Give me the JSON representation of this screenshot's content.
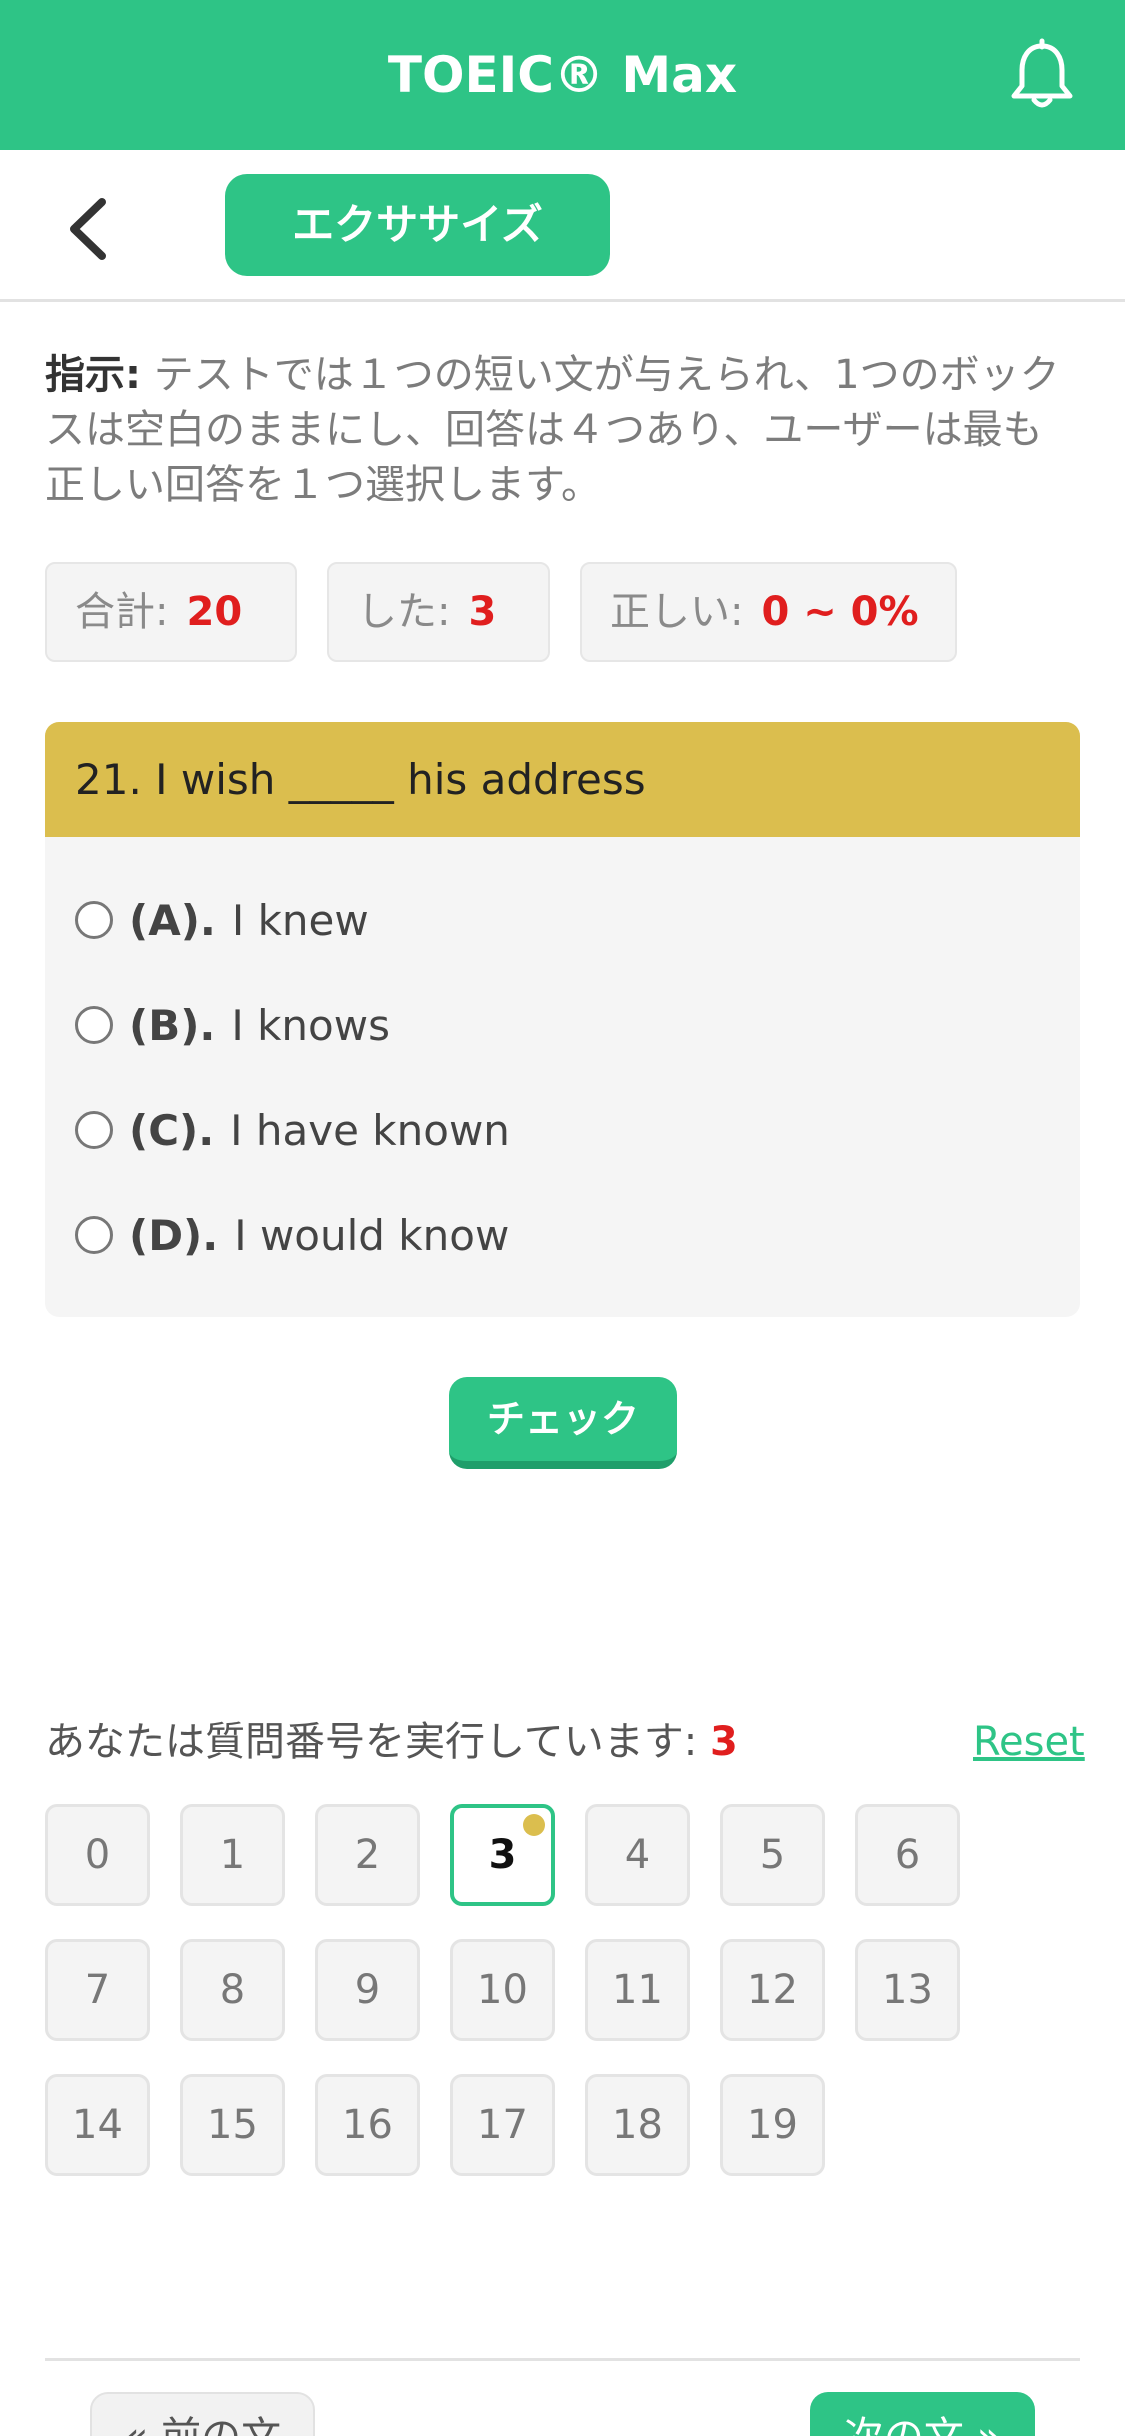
{
  "app": {
    "title": "TOEIC® Max"
  },
  "subbar": {
    "pill_label": "エクササイズ"
  },
  "instructions": {
    "label": "指示:",
    "text": " テストでは１つの短い文が与えられ、1つのボックスは空白のままにし、回答は４つあり、ユーザーは最も正しい回答を１つ選択します。"
  },
  "stats": [
    {
      "label": "合計:",
      "value": "20"
    },
    {
      "label": "した:",
      "value": "3"
    },
    {
      "label": "正しい:",
      "value": "0 ~ 0%"
    }
  ],
  "question": {
    "text": "21. I wish _____ his address",
    "options": [
      {
        "key": "(A).",
        "text": "I knew"
      },
      {
        "key": "(B).",
        "text": "I knows"
      },
      {
        "key": "(C).",
        "text": "I have known"
      },
      {
        "key": "(D).",
        "text": "I would know"
      }
    ]
  },
  "check_label": "チェック",
  "progress": {
    "label": "あなたは質問番号を実行しています:",
    "current": "3",
    "reset_label": "Reset",
    "numbers": [
      "0",
      "1",
      "2",
      "3",
      "4",
      "5",
      "6",
      "7",
      "8",
      "9",
      "10",
      "11",
      "12",
      "13",
      "14",
      "15",
      "16",
      "17",
      "18",
      "19"
    ],
    "active_index": 3
  },
  "nav": {
    "prev_label": "« 前の文",
    "next_label": "次の文 »"
  },
  "colors": {
    "accent": "#2ec486",
    "question_header": "#dbbe4e",
    "highlight": "#e01e1e"
  }
}
